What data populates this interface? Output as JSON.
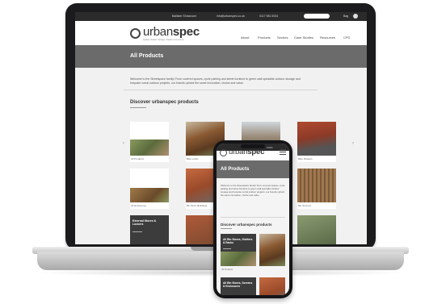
{
  "site": {
    "brand_light": "urban",
    "brand_bold": "spec",
    "tagline": "Quality Outdoor Storage, Shelters & Furniture",
    "topbar": {
      "showroom": "Ballister Showroom",
      "email": "info@urbanspec.co.uk",
      "phone": "0117 981 0034",
      "search_placeholder": "Search...",
      "cart": "Bag"
    },
    "nav": [
      "About",
      "Products",
      "Sectors",
      "Case Studies",
      "Resources",
      "CPD"
    ],
    "page_title": "All Products",
    "intro": "Welcome to the Streetspace family! From covered spaces, cycle parking and street furniture to green wall specialist outdoor storage and bespoke corral outdoor projects, our brands uphold the same innovation, choice and value.",
    "section_title": "Discover urbanspec products",
    "cards": [
      {
        "dark_title": "All Bin Stores, Shelters & Racks",
        "caption": "All Products"
      },
      {
        "caption": "Bike Locks"
      },
      {
        "caption": ""
      },
      {
        "caption": "Bike Shelters"
      },
      {
        "dark_title": "All Bin Stores, Screens & Enclosures",
        "caption": "All Enclosures"
      },
      {
        "caption": "Bin Store Buildings"
      },
      {
        "caption": ""
      },
      {
        "caption": "Bin Screens"
      },
      {
        "dark_title": "External Stores & Lockers",
        "caption": ""
      }
    ],
    "arrows": {
      "left": "‹",
      "right": "›"
    }
  },
  "phone": {
    "status": {
      "left": "9:41",
      "right": "100%"
    },
    "menu_icon": "hamburger-menu-icon",
    "page_title": "All Products",
    "intro": "Welcome to the Streetspace family! From covered spaces, cycle parking and street furniture to green wall specialist outdoor storage and bespoke corral outdoor projects, our brands uphold the same innovation, choice and value.",
    "section_title": "Discover urbanspec products",
    "cards": [
      {
        "dark_title": "All Bin Stores, Shelters & Racks",
        "caption": "All Products"
      },
      {
        "caption": ""
      },
      {
        "dark_title": "All Bin Stores, Screens & Enclosures",
        "caption": ""
      }
    ]
  },
  "colors": {
    "hero": "#6b6b6b",
    "topbar": "#2b2b2b",
    "dark_card": "#3c3c3c",
    "device": "#1b1b1d"
  }
}
